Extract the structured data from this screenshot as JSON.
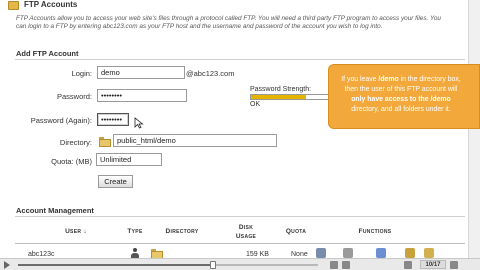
{
  "header": {
    "title": "FTP Accounts",
    "intro": "FTP Accounts allow you to access your web site's files through a protocol called FTP. You will need a third party FTP program to access your files. You can login to a FTP by entering abc123.com as your FTP host and the username and password of the account you wish to log into."
  },
  "add_account": {
    "section_title": "Add FTP Account",
    "login_label": "Login:",
    "login_value": "demo",
    "domain_suffix": "@abc123.com",
    "password_label": "Password:",
    "password_value": "••••••••",
    "password_again_label": "Password (Again):",
    "password_again_value": "••••••••",
    "strength_label": "Password Strength:",
    "strength_status": "OK",
    "strength_fraction": 0.7,
    "directory_label": "Directory:",
    "directory_value": "public_html/demo",
    "quota_label": "Quota: (MB)",
    "quota_value": "Unlimited",
    "create_button": "Create"
  },
  "callout": {
    "line1_pre": "If you leave ",
    "line1_bold": "/demo",
    "line1_post": " in the directory box,",
    "line2": "then the user of this FTP account will",
    "line3_bold": "only have access to the /demo",
    "line4": "directory, and all folders under it."
  },
  "management": {
    "section_title": "Account Management",
    "columns": {
      "user": "User",
      "sort_arrow": "↓",
      "type": "Type",
      "directory": "Directory",
      "disk_usage": "Disk Usage",
      "quota": "Quota",
      "functions": "Functions"
    },
    "row": {
      "user": "abc123c",
      "disk_usage": "159 KB",
      "quota": "None"
    }
  },
  "video": {
    "counter": "10/17",
    "progress_fraction": 0.65
  },
  "colors": {
    "callout": "#f2a83a",
    "strength_fill": "#e6b400"
  }
}
